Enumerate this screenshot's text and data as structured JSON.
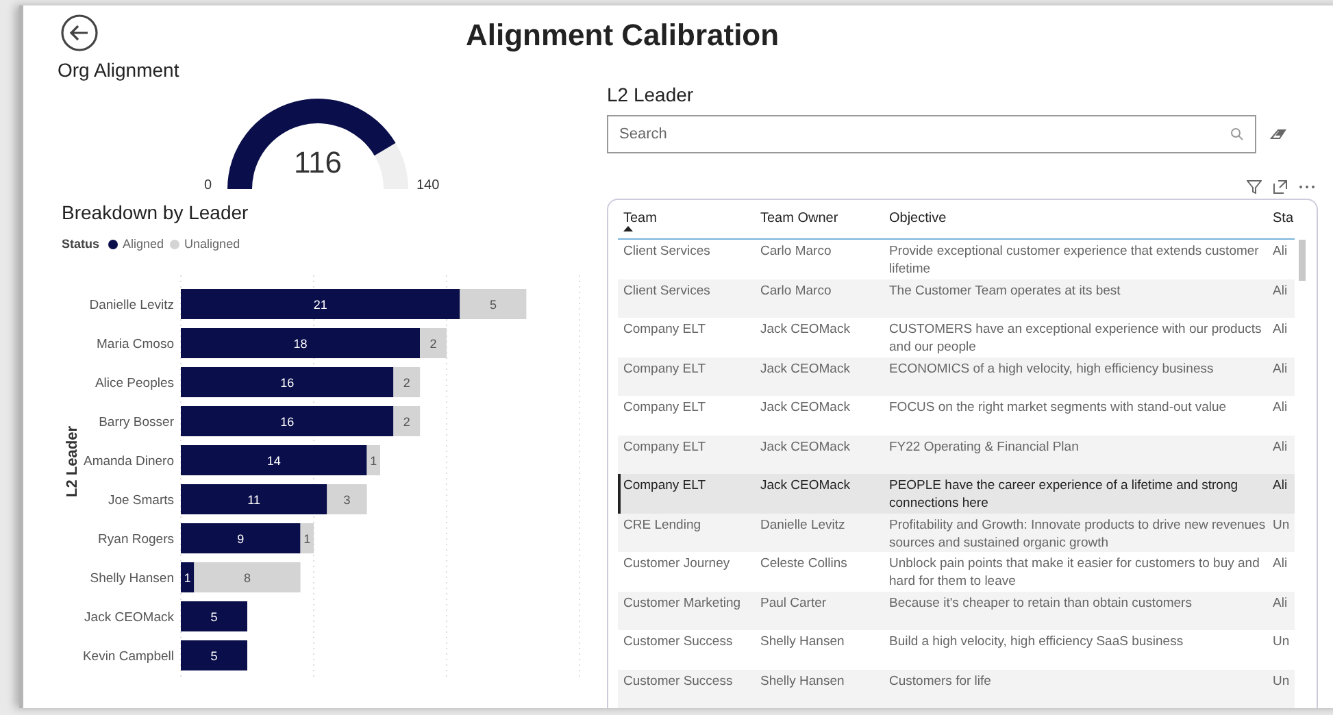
{
  "header": {
    "title": "Alignment Calibration"
  },
  "org_alignment": {
    "title": "Org Alignment",
    "value": "116",
    "min": "0",
    "max": "140"
  },
  "breakdown": {
    "title": "Breakdown by Leader",
    "legend_title": "Status",
    "chart_data": {
      "type": "bar",
      "orientation": "horizontal",
      "stacked": true,
      "data_labels": true,
      "ylabel": "L2 Leader",
      "categories": [
        "Danielle Levitz",
        "Maria Cmoso",
        "Alice Peoples",
        "Barry Bosser",
        "Amanda Dinero",
        "Joe Smarts",
        "Ryan Rogers",
        "Shelly Hansen",
        "Jack CEOMack",
        "Kevin Campbell"
      ],
      "series": [
        {
          "name": "Aligned",
          "color": "#0a0e4a",
          "values": [
            21,
            18,
            16,
            16,
            14,
            11,
            9,
            1,
            5,
            5
          ]
        },
        {
          "name": "Unaligned",
          "color": "#d4d4d4",
          "values": [
            5,
            2,
            2,
            2,
            1,
            3,
            1,
            8,
            null,
            null
          ]
        }
      ]
    }
  },
  "l2_leader": {
    "title": "L2 Leader",
    "search": {
      "placeholder": "Search"
    }
  },
  "table": {
    "columns": [
      {
        "label": "Team",
        "sorted": true
      },
      {
        "label": "Team Owner",
        "sorted": false
      },
      {
        "label": "Objective",
        "sorted": false
      },
      {
        "label": "Sta",
        "sorted": false
      }
    ],
    "rows": [
      {
        "cells": [
          "Client Services",
          "Carlo Marco",
          "Provide exceptional customer experience that extends customer lifetime",
          "Ali"
        ],
        "selected": false
      },
      {
        "cells": [
          "Client Services",
          "Carlo Marco",
          "The Customer Team operates at its best",
          "Ali"
        ],
        "selected": false
      },
      {
        "cells": [
          "Company ELT",
          "Jack CEOMack",
          "CUSTOMERS have an exceptional experience with our products and our people",
          "Ali"
        ],
        "selected": false
      },
      {
        "cells": [
          "Company ELT",
          "Jack CEOMack",
          "ECONOMICS of a high velocity, high efficiency business",
          "Ali"
        ],
        "selected": false
      },
      {
        "cells": [
          "Company ELT",
          "Jack CEOMack",
          "FOCUS on the right market segments with stand-out value",
          "Ali"
        ],
        "selected": false
      },
      {
        "cells": [
          "Company ELT",
          "Jack CEOMack",
          "FY22 Operating & Financial Plan",
          "Ali"
        ],
        "selected": false
      },
      {
        "cells": [
          "Company ELT",
          "Jack CEOMack",
          "PEOPLE have the career experience of a lifetime and strong connections here",
          "Ali"
        ],
        "selected": true
      },
      {
        "cells": [
          "CRE Lending",
          "Danielle Levitz",
          "Profitability and Growth: Innovate products to drive new revenues sources and sustained organic growth",
          "Un"
        ],
        "selected": false
      },
      {
        "cells": [
          "Customer Journey",
          "Celeste Collins",
          "Unblock pain points that make it easier for customers to buy and hard for them to leave",
          "Ali"
        ],
        "selected": false
      },
      {
        "cells": [
          "Customer Marketing",
          "Paul Carter",
          "Because it's cheaper to retain than obtain customers",
          "Ali"
        ],
        "selected": false
      },
      {
        "cells": [
          "Customer Success",
          "Shelly Hansen",
          "Build a high velocity, high efficiency SaaS business",
          "Un"
        ],
        "selected": false
      },
      {
        "cells": [
          "Customer Success",
          "Shelly Hansen",
          "Customers for life",
          "Un"
        ],
        "selected": false
      }
    ]
  }
}
